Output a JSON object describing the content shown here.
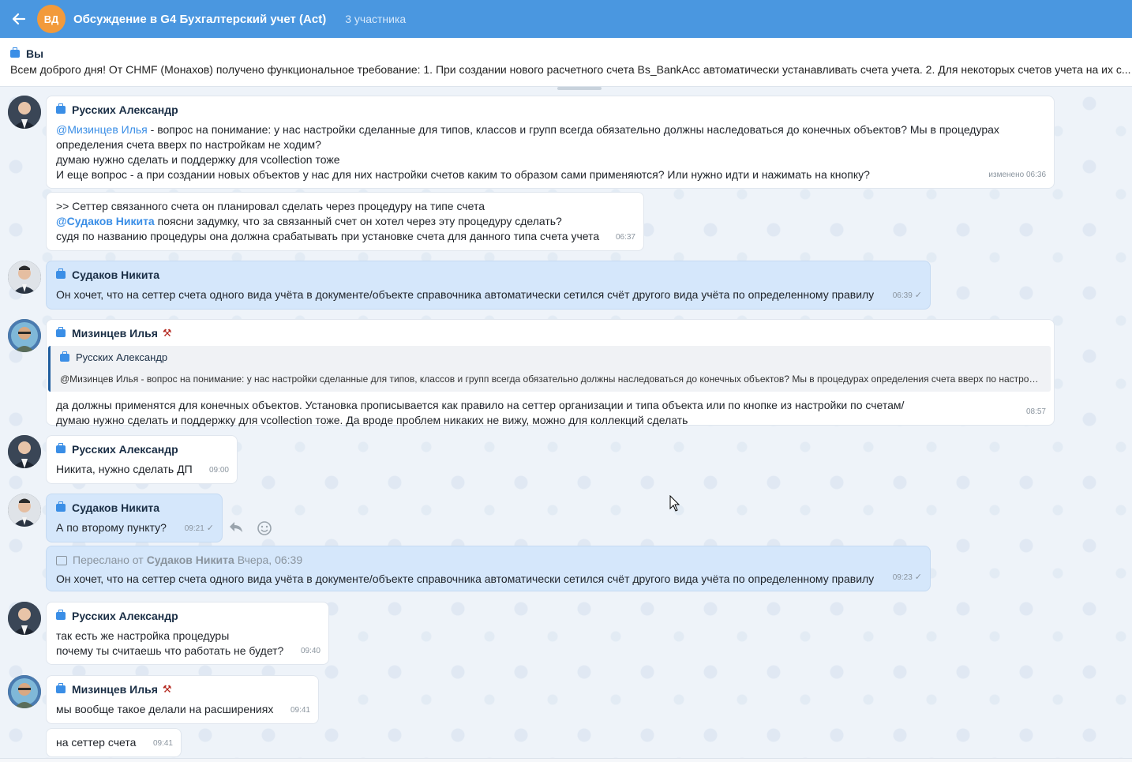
{
  "header": {
    "avatar_initials": "ВД",
    "title": "Обсуждение в G4 Бухгалтерский учет (Act)",
    "subtitle": "3 участника"
  },
  "pinned": {
    "author": "Вы",
    "text": "Всем доброго дня! От CHMF (Монахов) получено функциональное требование: 1. При создании нового расчетного счета Bs_BankAcc автоматически устанавливать счета учета. 2. Для некоторых счетов учета на их с..."
  },
  "messages": {
    "m1": {
      "author": "Русских Александр",
      "mention": "@Мизинцев Илья",
      "l1": " - вопрос на понимание: у нас настройки сделанные для типов, классов и групп всегда обязательно должны наследоваться до конечных объектов? Мы в процедурах",
      "l2": "определения счета вверх по настройкам не ходим?",
      "l3": "думаю нужно сделать и поддержку для vcollection тоже",
      "l4": "И еще вопрос - а при создании новых объектов у нас для них настройки счетов каким то образом сами применяются? Или нужно идти и нажимать на кнопку?",
      "time": "изменено  06:36"
    },
    "m2": {
      "l1": ">> Сеттер связанного счета он планировал сделать через процедуру на типе счета",
      "mention": "@Судаков Никита",
      "l2": " поясни задумку, что за связанный счет он хотел через эту процедуру сделать?",
      "l3": "судя по названию процедуры она должна срабатывать при установке счета для данного типа счета учета",
      "time": "06:37"
    },
    "m3": {
      "author": "Судаков Никита",
      "text": "Он хочет, что на сеттер счета одного вида учёта в документе/объекте справочника автоматически сетился счёт другого вида учёта по определенному правилу",
      "time": "06:39"
    },
    "m4": {
      "author": "Мизинцев Илья",
      "quote_author": "Русских Александр",
      "quote_text": "@Мизинцев Илья - вопрос на понимание: у нас настройки сделанные для типов, классов и групп всегда обязательно должны наследоваться до конечных объектов? Мы в процедурах определения счета вверх по настройкам не ходим?",
      "l1": "да должны применятся для конечных объектов. Установка прописывается как правило на сеттер организации и типа объекта или по кнопке из настройки по счетам/",
      "l2": "думаю нужно сделать и поддержку для vcollection тоже. Да вроде проблем никаких не вижу, можно для коллекций сделать",
      "time": "08:57"
    },
    "m5": {
      "author": "Русских Александр",
      "text": "Никита, нужно сделать ДП",
      "time": "09:00"
    },
    "m6": {
      "author": "Судаков Никита",
      "text": "А по второму пункту?",
      "time": "09:21"
    },
    "m7": {
      "fwd_prefix": "Переслано от",
      "fwd_author": "Судаков Никита",
      "fwd_when": "Вчера, 06:39",
      "text": "Он хочет, что на сеттер счета одного вида учёта в документе/объекте справочника автоматически сетился счёт другого вида учёта по определенному правилу",
      "time": "09:23"
    },
    "m8": {
      "author": "Русских Александр",
      "l1": "так есть же настройка процедуры",
      "l2": "почему ты считаешь что работать не будет?",
      "time": "09:40"
    },
    "m9": {
      "author": "Мизинцев Илья",
      "text": "мы вообще такое делали на расширениях",
      "time": "09:41"
    },
    "m10": {
      "text": "на сеттер счета",
      "time": "09:41"
    }
  }
}
